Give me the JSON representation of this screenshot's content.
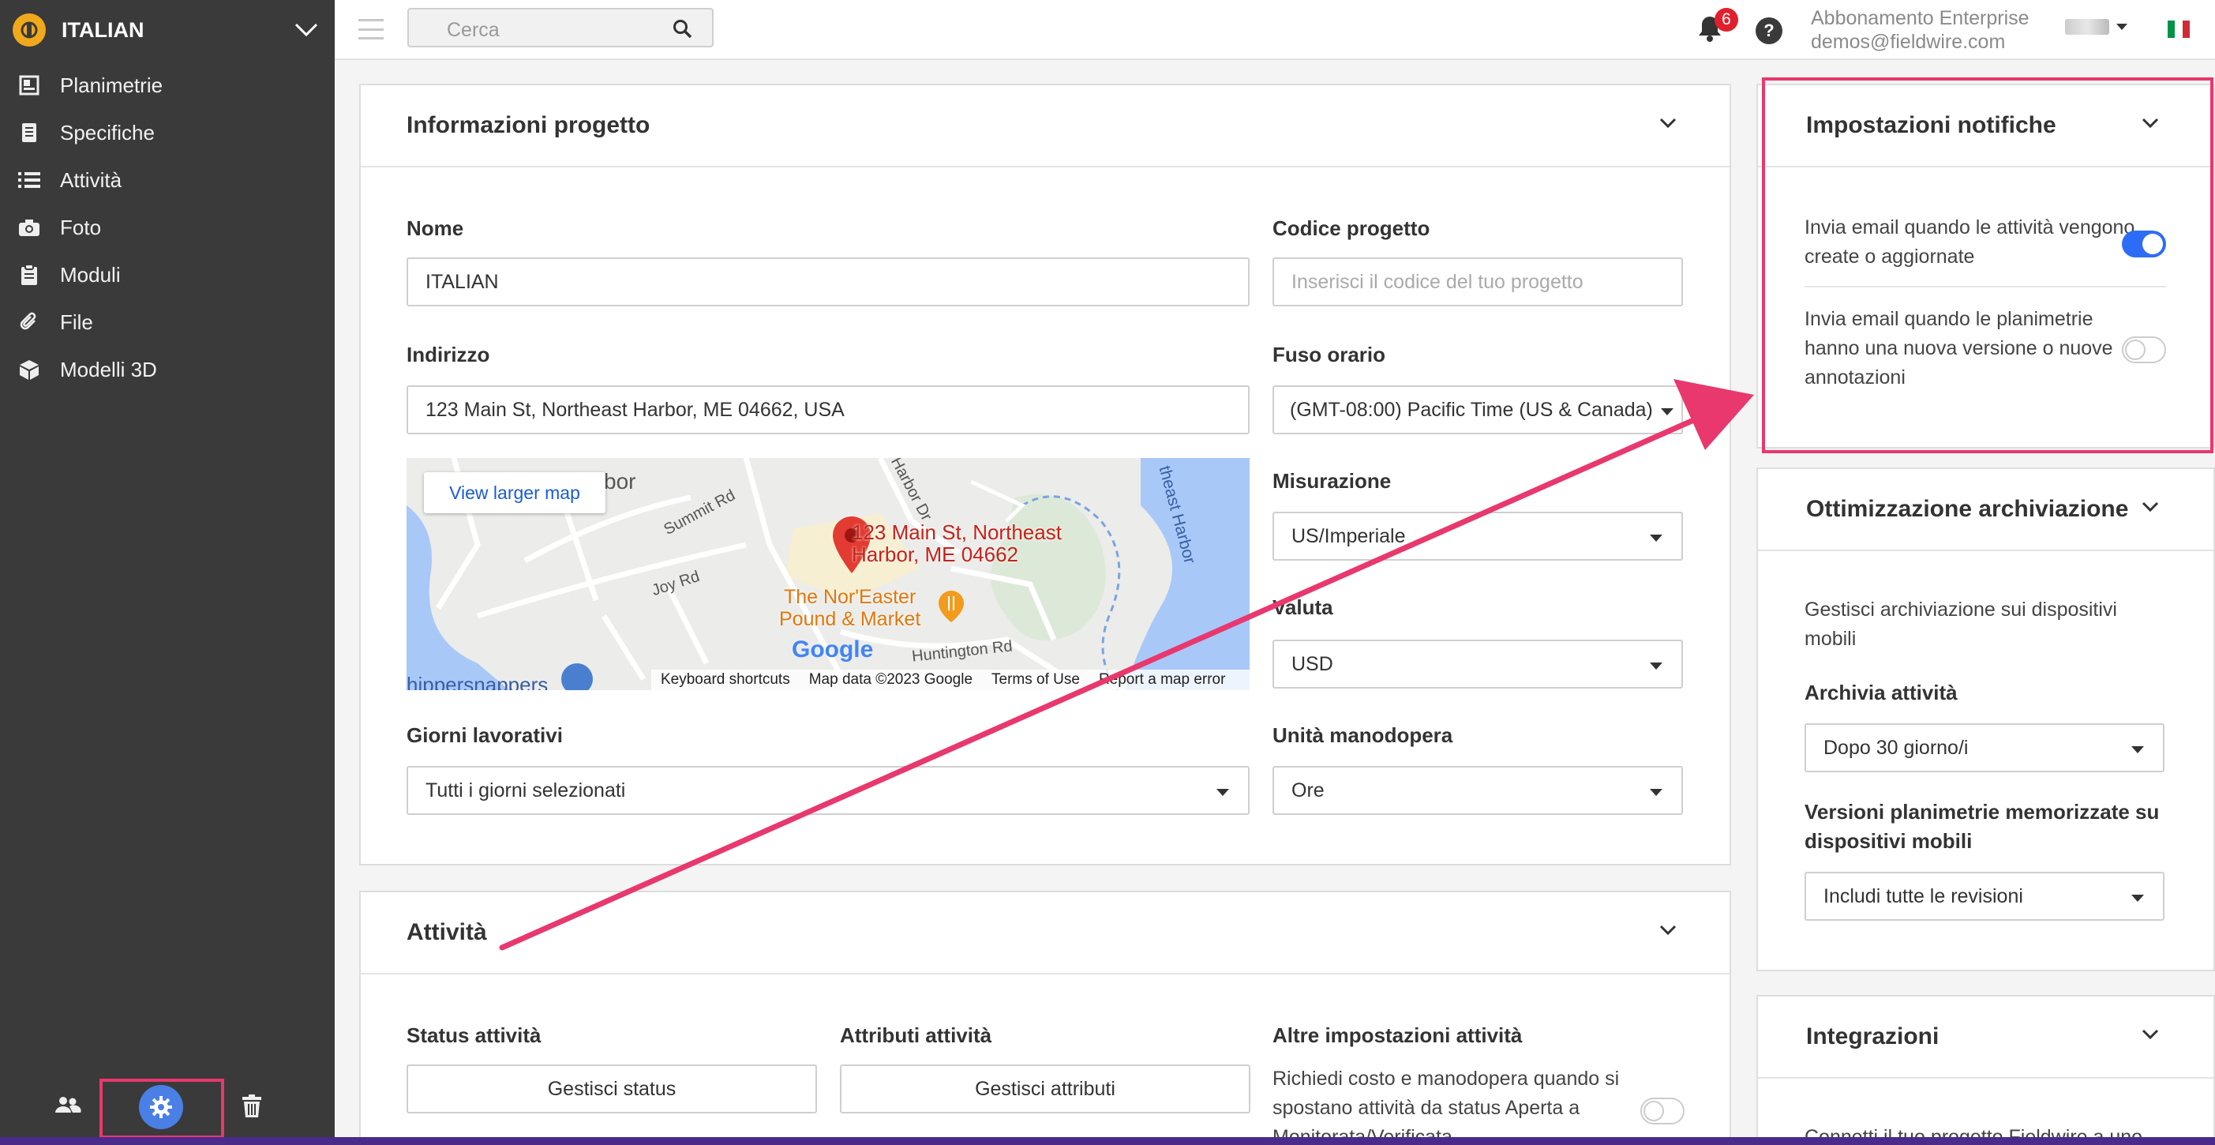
{
  "sidebar": {
    "project_logo": "fieldwire-logo",
    "project_name": "ITALIAN",
    "items": [
      {
        "label": "Planimetrie",
        "icon": "plans-icon"
      },
      {
        "label": "Specifiche",
        "icon": "specs-icon"
      },
      {
        "label": "Attività",
        "icon": "list-icon"
      },
      {
        "label": "Foto",
        "icon": "camera-icon"
      },
      {
        "label": "Moduli",
        "icon": "clipboard-icon"
      },
      {
        "label": "File",
        "icon": "paperclip-icon"
      },
      {
        "label": "Modelli 3D",
        "icon": "cube-icon"
      }
    ],
    "bottom": [
      "people-icon",
      "gear-icon",
      "trash-icon"
    ]
  },
  "topbar": {
    "search_placeholder": "Cerca",
    "notification_count": "6",
    "help_label": "?",
    "account_plan": "Abbonamento Enterprise",
    "account_email": "demos@fieldwire.com",
    "language_flag": "italy-flag"
  },
  "project_info": {
    "title": "Informazioni progetto",
    "name_label": "Nome",
    "name_value": "ITALIAN",
    "code_label": "Codice progetto",
    "code_placeholder": "Inserisci il codice del tuo progetto",
    "address_label": "Indirizzo",
    "address_value": "123 Main St, Northeast Harbor, ME 04662, USA",
    "timezone_label": "Fuso orario",
    "timezone_value": "(GMT-08:00) Pacific Time (US & Canada)",
    "measurement_label": "Misurazione",
    "measurement_value": "US/Imperiale",
    "currency_label": "Valuta",
    "currency_value": "USD",
    "workdays_label": "Giorni lavorativi",
    "workdays_value": "Tutti i giorni selezionati",
    "labor_label": "Unità manodopera",
    "labor_value": "Ore"
  },
  "map": {
    "view_larger": "View larger map",
    "pin_label_1": "123 Main St, Northeast",
    "pin_label_2": "Harbor, ME 04662",
    "poi_1": "The Nor'Easter",
    "poi_2": "Pound & Market",
    "street_1": "Summit Rd",
    "street_2": "Joy Rd",
    "street_3": "Huntington Rd",
    "street_4": "Harbor Dr",
    "street_5": "theast Harbor",
    "street_6": "bor",
    "poi_3": "hippersnappers",
    "google": "Google",
    "footer": [
      "Keyboard shortcuts",
      "Map data ©2023 Google",
      "Terms of Use",
      "Report a map error"
    ]
  },
  "tasks": {
    "title": "Attività",
    "status_label": "Status attività",
    "status_button": "Gestisci status",
    "attributes_label": "Attributi attività",
    "attributes_button": "Gestisci attributi",
    "other_label": "Altre impostazioni attività",
    "other_text": "Richiedi costo e manodopera quando si spostano attività da status Aperta a Monitorata/Verificata"
  },
  "notifications": {
    "title": "Impostazioni notifiche",
    "email_tasks": "Invia email quando le attività vengono create o aggiornate",
    "email_tasks_on": true,
    "email_plans": "Invia email quando le planimetrie hanno una nuova versione o nuove annotazioni",
    "email_plans_on": false
  },
  "storage": {
    "title": "Ottimizzazione archiviazione",
    "description": "Gestisci archiviazione sui dispositivi mobili",
    "archive_label": "Archivia attività",
    "archive_value": "Dopo 30 giorno/i",
    "versions_label": "Versioni planimetrie memorizzate su dispositivi mobili",
    "versions_value": "Includi tutte le revisioni"
  },
  "integrations": {
    "title": "Integrazioni",
    "description": "Connetti il tuo progetto Fieldwire a uno"
  },
  "colors": {
    "sidebar_bg": "#3a3a3a",
    "accent_blue": "#2d6cf6",
    "highlight_pink": "#e8386e",
    "badge_red": "#e0202c"
  }
}
